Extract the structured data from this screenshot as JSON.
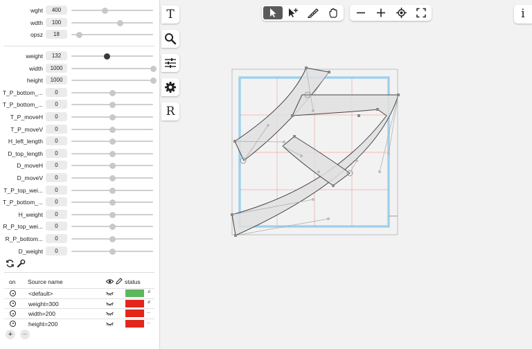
{
  "font_axes": [
    {
      "label": "wght",
      "value": "400",
      "fraction": 0.41
    },
    {
      "label": "wdth",
      "value": "100",
      "fraction": 0.6
    },
    {
      "label": "opsz",
      "value": "18",
      "fraction": 0.1
    }
  ],
  "glyph_axes": [
    {
      "label": "weight",
      "value": "132",
      "fraction": 0.44,
      "active": true
    },
    {
      "label": "width",
      "value": "1000",
      "fraction": 1.0
    },
    {
      "label": "height",
      "value": "1000",
      "fraction": 1.0
    },
    {
      "label": "T_P_bottom_...",
      "value": "0",
      "fraction": 0.5
    },
    {
      "label": "T_P_bottom_...",
      "value": "0",
      "fraction": 0.5
    },
    {
      "label": "T_P_moveH",
      "value": "0",
      "fraction": 0.5
    },
    {
      "label": "T_P_moveV",
      "value": "0",
      "fraction": 0.5
    },
    {
      "label": "H_left_length",
      "value": "0",
      "fraction": 0.5
    },
    {
      "label": "D_top_length",
      "value": "0",
      "fraction": 0.5
    },
    {
      "label": "D_moveH",
      "value": "0",
      "fraction": 0.5
    },
    {
      "label": "D_moveV",
      "value": "0",
      "fraction": 0.5
    },
    {
      "label": "T_P_top_wei...",
      "value": "0",
      "fraction": 0.5
    },
    {
      "label": "T_P_bottom_...",
      "value": "0",
      "fraction": 0.5
    },
    {
      "label": "H_weight",
      "value": "0",
      "fraction": 0.5
    },
    {
      "label": "R_P_top_wei...",
      "value": "0",
      "fraction": 0.5
    },
    {
      "label": "R_P_bottom...",
      "value": "0",
      "fraction": 0.5
    },
    {
      "label": "D_weight",
      "value": "0",
      "fraction": 0.5
    }
  ],
  "sources": {
    "header": {
      "on": "on",
      "name": "Source name",
      "status": "status"
    },
    "rows": [
      {
        "name": "<default>",
        "status_color": "#5cb85c",
        "status_glyph": ".ıl"
      },
      {
        "name": "weight=300",
        "status_color": "#e3261c",
        "status_glyph": ".ıl"
      },
      {
        "name": "width=200",
        "status_color": "#e3261c",
        "status_glyph": "..."
      },
      {
        "name": "height=200",
        "status_color": "#e3261c",
        "status_glyph": "..."
      }
    ]
  },
  "list_controls": {
    "add": "+",
    "remove": "−"
  },
  "side_tools": {
    "text_glyph": "T",
    "reference_glyph": "R"
  },
  "info_label": "i",
  "colors": {
    "accent_active": "#5a5a5a",
    "glyph_fill": "#e0e0e0",
    "guide_blue": "#a8d4f0",
    "guide_red": "#f0a8a8"
  }
}
